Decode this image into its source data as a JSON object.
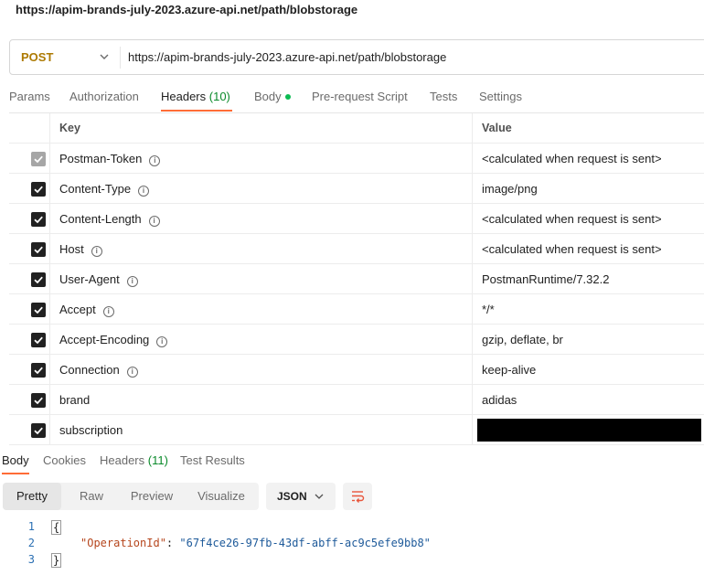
{
  "page": {
    "title": "https://apim-brands-july-2023.azure-api.net/path/blobstorage"
  },
  "request": {
    "method": "POST",
    "url": "https://apim-brands-july-2023.azure-api.net/path/blobstorage"
  },
  "request_tabs": {
    "params": "Params",
    "authorization": "Authorization",
    "headers": "Headers",
    "headers_count": "(10)",
    "body": "Body",
    "pre_request": "Pre-request Script",
    "tests": "Tests",
    "settings": "Settings"
  },
  "headers_table": {
    "key_header": "Key",
    "value_header": "Value",
    "rows": [
      {
        "key": "Postman-Token",
        "value": "<calculated when request is sent>",
        "checked": true,
        "disabled": true,
        "info": true
      },
      {
        "key": "Content-Type",
        "value": "image/png",
        "checked": true,
        "info": true
      },
      {
        "key": "Content-Length",
        "value": "<calculated when request is sent>",
        "checked": true,
        "info": true
      },
      {
        "key": "Host",
        "value": "<calculated when request is sent>",
        "checked": true,
        "info": true
      },
      {
        "key": "User-Agent",
        "value": "PostmanRuntime/7.32.2",
        "checked": true,
        "info": true
      },
      {
        "key": "Accept",
        "value": "*/*",
        "checked": true,
        "info": true
      },
      {
        "key": "Accept-Encoding",
        "value": "gzip, deflate, br",
        "checked": true,
        "info": true
      },
      {
        "key": "Connection",
        "value": "keep-alive",
        "checked": true,
        "info": true
      },
      {
        "key": "brand",
        "value": "adidas",
        "checked": true,
        "info": false
      },
      {
        "key": "subscription",
        "value": "",
        "checked": true,
        "info": false,
        "redacted": true
      }
    ]
  },
  "response_tabs": {
    "body": "Body",
    "cookies": "Cookies",
    "headers": "Headers",
    "headers_count": "(11)",
    "test_results": "Test Results"
  },
  "response_view": {
    "pretty": "Pretty",
    "raw": "Raw",
    "preview": "Preview",
    "visualize": "Visualize",
    "format": "JSON"
  },
  "response_body": {
    "line_numbers": [
      "1",
      "2",
      "3"
    ],
    "open_brace": "{",
    "close_brace": "}",
    "key": "\"OperationId\"",
    "colon": ": ",
    "value": "\"67f4ce26-97fb-43df-abff-ac9c5efe9bb8\""
  },
  "colors": {
    "accent": "#ff6c37",
    "method": "#ad7a03",
    "count_green": "#0a8a2a",
    "json_key": "#b6461d",
    "json_value": "#1e5a9a"
  }
}
